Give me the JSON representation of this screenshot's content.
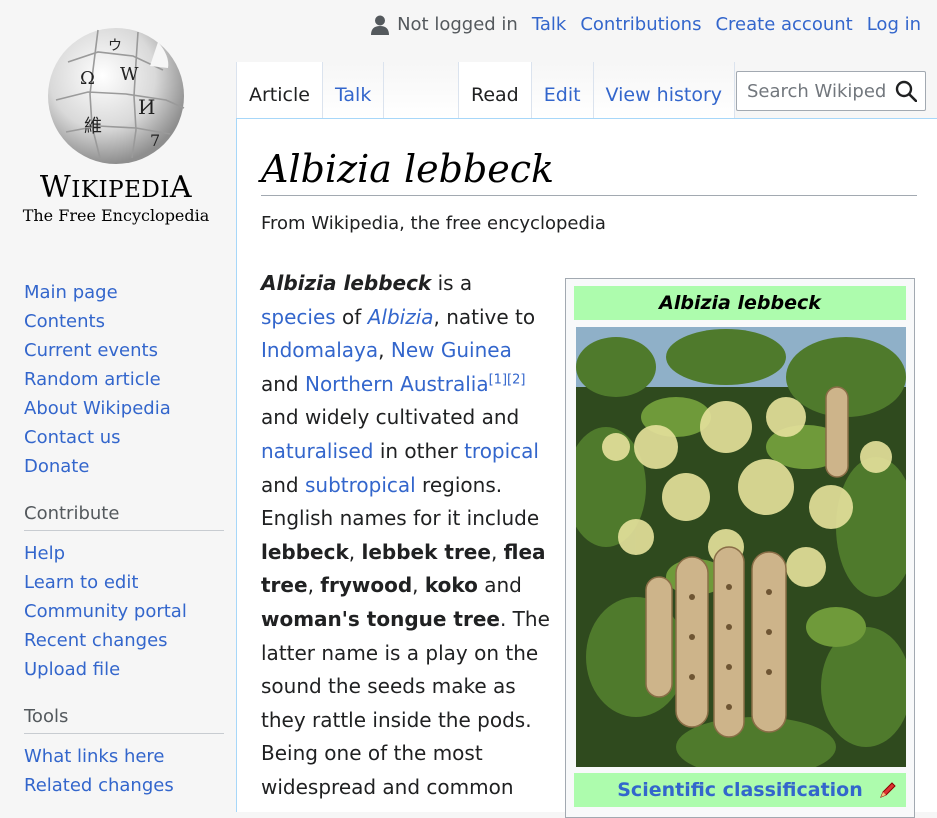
{
  "logo": {
    "wordmark_first": "W",
    "wordmark_rest": "IKIPEDI",
    "wordmark_last": "A",
    "tagline": "The Free Encyclopedia",
    "glyphs": [
      "Ω",
      "W",
      "И",
      "維",
      "ウ",
      "7"
    ]
  },
  "personal_tools": {
    "status": "Not logged in",
    "links": [
      "Talk",
      "Contributions",
      "Create account",
      "Log in"
    ]
  },
  "navigation": {
    "items": [
      "Main page",
      "Contents",
      "Current events",
      "Random article",
      "About Wikipedia",
      "Contact us",
      "Donate"
    ]
  },
  "contribute": {
    "heading": "Contribute",
    "items": [
      "Help",
      "Learn to edit",
      "Community portal",
      "Recent changes",
      "Upload file"
    ]
  },
  "tools": {
    "heading": "Tools",
    "items": [
      "What links here",
      "Related changes"
    ]
  },
  "tabs": {
    "left": [
      "Article",
      "Talk"
    ],
    "right": [
      "Read",
      "Edit",
      "View history"
    ]
  },
  "search": {
    "placeholder": "Search Wikipedia"
  },
  "article": {
    "title": "Albizia lebbeck",
    "tagline": "From Wikipedia, the free encyclopedia",
    "p": {
      "t1": "Albizia lebbeck",
      "t2": " is a ",
      "l_species": "species",
      "t3": " of ",
      "l_albizia": "Albizia",
      "t4": ", native to ",
      "l_indomalaya": "Indomalaya",
      "t5": ", ",
      "l_newguinea": "New Guinea",
      "t6": " and ",
      "l_australia": "Northern Australia",
      "ref1": "[1]",
      "ref2": "[2]",
      "t7": " and widely cultivated and ",
      "l_naturalised": "naturalised",
      "t8": " in other ",
      "l_tropical": "tropical",
      "t9": " and ",
      "l_subtropical": "subtropical",
      "t10": " regions. English names for it include ",
      "b1": "lebbeck",
      "c1": ", ",
      "b2": "lebbek tree",
      "c2": ", ",
      "b3": "flea tree",
      "c3": ", ",
      "b4": "frywood",
      "c4": ", ",
      "b5": "koko",
      "c5": " and ",
      "b6": "woman's tongue tree",
      "t11": ". The latter name is a play on the sound the seeds make as they rattle inside the pods. Being one of the most widespread and common"
    }
  },
  "infobox": {
    "title": "Albizia lebbeck",
    "classification": "Scientific classification"
  },
  "colors": {
    "link": "#3366cc",
    "infobox_header": "#adfcad",
    "tab_border": "#a7d7f9"
  }
}
